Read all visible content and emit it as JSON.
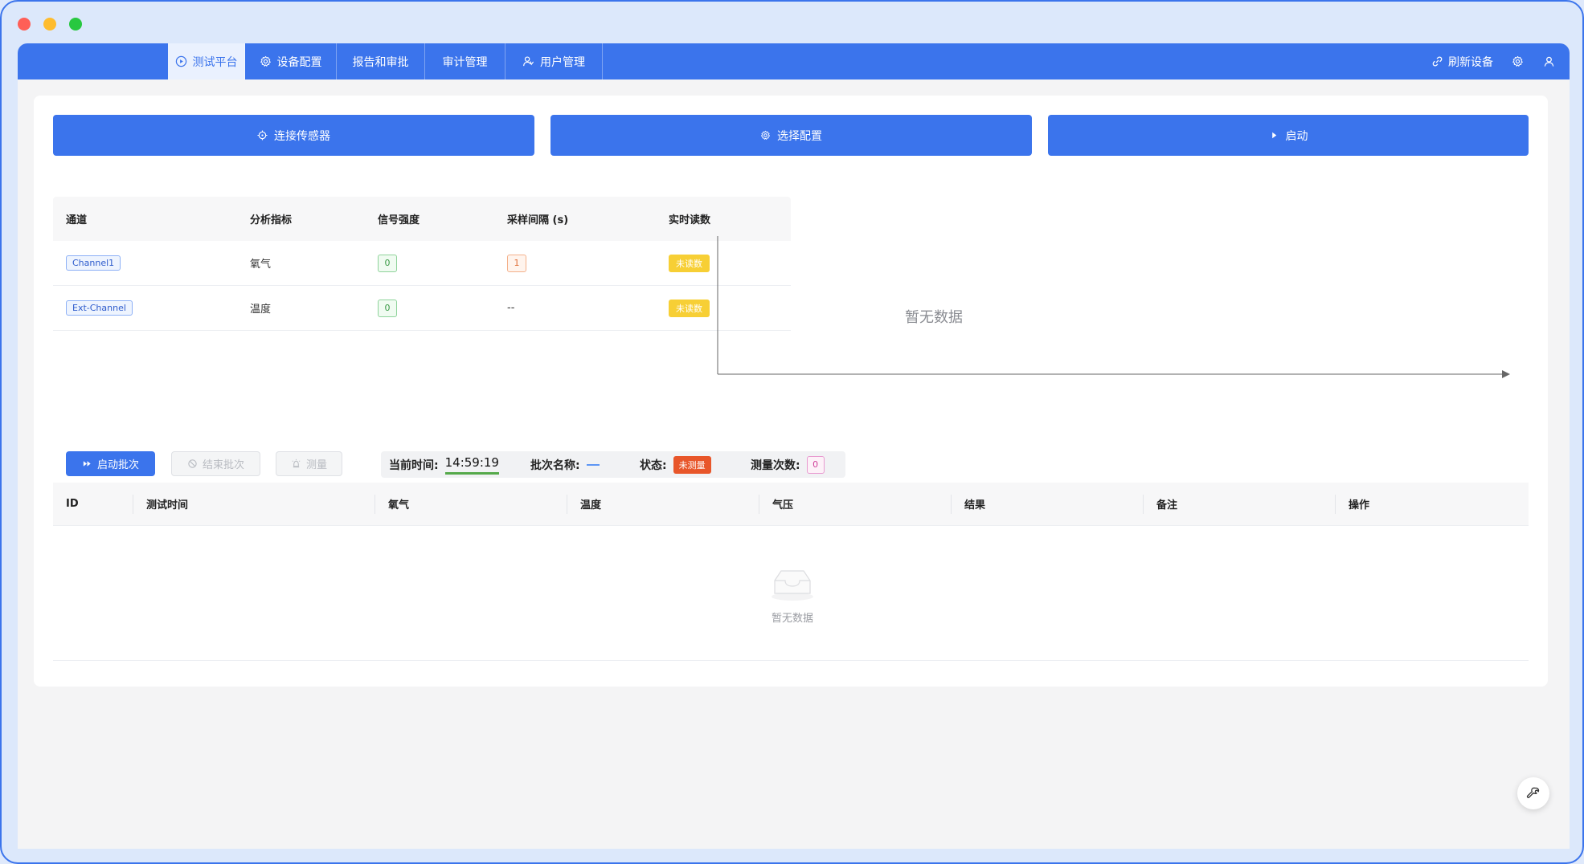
{
  "nav": {
    "tabs": [
      {
        "label": "测试平台",
        "icon": "play-circle-icon"
      },
      {
        "label": "设备配置",
        "icon": "gear-icon"
      },
      {
        "label": "报告和审批",
        "icon": ""
      },
      {
        "label": "审计管理",
        "icon": ""
      },
      {
        "label": "用户管理",
        "icon": "users-icon"
      }
    ],
    "refresh_label": "刷新设备"
  },
  "actions": {
    "connect_label": "连接传感器",
    "config_label": "选择配置",
    "start_label": "启动"
  },
  "channel_table": {
    "headers": [
      "通道",
      "分析指标",
      "信号强度",
      "采样间隔 (s)",
      "实时读数"
    ],
    "rows": [
      {
        "channel": "Channel1",
        "metric": "氧气",
        "signal": "0",
        "interval": "1",
        "reading": "未读数"
      },
      {
        "channel": "Ext-Channel",
        "metric": "温度",
        "signal": "0",
        "interval": "--",
        "reading": "未读数"
      }
    ]
  },
  "chart": {
    "empty_text": "暂无数据"
  },
  "batch": {
    "start_label": "启动批次",
    "end_label": "结束批次",
    "measure_label": "测量"
  },
  "status": {
    "time_label": "当前时间:",
    "time_value": "14:59:19",
    "batch_name_label": "批次名称:",
    "state_label": "状态:",
    "state_value": "未测量",
    "count_label": "测量次数:",
    "count_value": "0"
  },
  "measure_table": {
    "headers": [
      "ID",
      "测试时间",
      "氧气",
      "温度",
      "气压",
      "结果",
      "备注",
      "操作"
    ],
    "empty_text": "暂无数据"
  },
  "colors": {
    "primary": "#3b74ec",
    "warning": "#f7cf35",
    "danger": "#e8562a"
  }
}
